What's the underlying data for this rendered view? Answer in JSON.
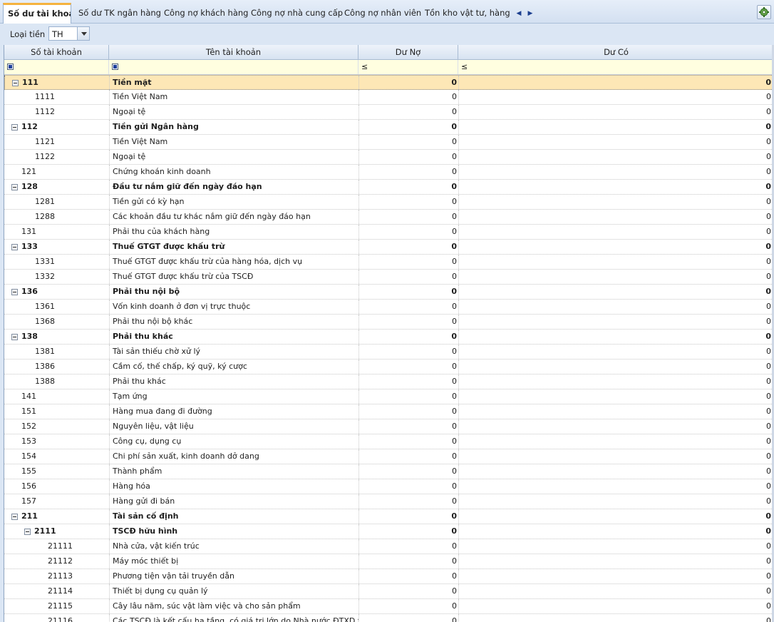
{
  "tabs": [
    {
      "label": "Số dư tài khoản",
      "active": true
    },
    {
      "label": "Số dư TK ngân hàng"
    },
    {
      "label": "Công nợ khách hàng"
    },
    {
      "label": "Công nợ nhà cung cấp"
    },
    {
      "label": "Công nợ nhân viên"
    },
    {
      "label": "Tồn kho vật tư, hàng hóa"
    }
  ],
  "toolbar": {
    "currency_label": "Loại tiền",
    "currency_value": "TH"
  },
  "columns": {
    "account_no": "Số tài khoản",
    "account_name": "Tên tài khoản",
    "debit": "Dư Nợ",
    "credit": "Dư Có"
  },
  "filter": {
    "debit_op": "≤",
    "credit_op": "≤"
  },
  "rows": [
    {
      "code": "111",
      "name": "Tiền mặt",
      "debit": "0",
      "credit": "0",
      "level": 0,
      "group": true
    },
    {
      "code": "1111",
      "name": "Tiền Việt Nam",
      "debit": "0",
      "credit": "0",
      "level": 1
    },
    {
      "code": "1112",
      "name": "Ngoại tệ",
      "debit": "0",
      "credit": "0",
      "level": 1
    },
    {
      "code": "112",
      "name": "Tiền gửi Ngân hàng",
      "debit": "0",
      "credit": "0",
      "level": 0,
      "group": true
    },
    {
      "code": "1121",
      "name": "Tiền Việt Nam",
      "debit": "0",
      "credit": "0",
      "level": 1
    },
    {
      "code": "1122",
      "name": "Ngoại tệ",
      "debit": "0",
      "credit": "0",
      "level": 1
    },
    {
      "code": "121",
      "name": "Chứng khoán kinh doanh",
      "debit": "0",
      "credit": "0",
      "level": 0
    },
    {
      "code": "128",
      "name": "Đầu tư nắm giữ đến ngày đáo hạn",
      "debit": "0",
      "credit": "0",
      "level": 0,
      "group": true
    },
    {
      "code": "1281",
      "name": "Tiền gửi có kỳ hạn",
      "debit": "0",
      "credit": "0",
      "level": 1
    },
    {
      "code": "1288",
      "name": "Các khoản đầu tư khác nắm giữ đến ngày đáo hạn",
      "debit": "0",
      "credit": "0",
      "level": 1
    },
    {
      "code": "131",
      "name": "Phải thu của khách hàng",
      "debit": "0",
      "credit": "0",
      "level": 0
    },
    {
      "code": "133",
      "name": "Thuế GTGT được khấu trừ",
      "debit": "0",
      "credit": "0",
      "level": 0,
      "group": true
    },
    {
      "code": "1331",
      "name": "Thuế GTGT được khấu trừ của hàng hóa, dịch vụ",
      "debit": "0",
      "credit": "0",
      "level": 1
    },
    {
      "code": "1332",
      "name": "Thuế GTGT được khấu trừ của TSCĐ",
      "debit": "0",
      "credit": "0",
      "level": 1
    },
    {
      "code": "136",
      "name": "Phải thu nội bộ",
      "debit": "0",
      "credit": "0",
      "level": 0,
      "group": true
    },
    {
      "code": "1361",
      "name": "Vốn kinh doanh ở đơn vị trực thuộc",
      "debit": "0",
      "credit": "0",
      "level": 1
    },
    {
      "code": "1368",
      "name": "Phải thu nội bộ khác",
      "debit": "0",
      "credit": "0",
      "level": 1
    },
    {
      "code": "138",
      "name": "Phải thu khác",
      "debit": "0",
      "credit": "0",
      "level": 0,
      "group": true
    },
    {
      "code": "1381",
      "name": "Tài sản thiếu chờ xử lý",
      "debit": "0",
      "credit": "0",
      "level": 1
    },
    {
      "code": "1386",
      "name": "Cầm cố, thế chấp, ký quỹ, ký cược",
      "debit": "0",
      "credit": "0",
      "level": 1
    },
    {
      "code": "1388",
      "name": "Phải thu khác",
      "debit": "0",
      "credit": "0",
      "level": 1
    },
    {
      "code": "141",
      "name": "Tạm ứng",
      "debit": "0",
      "credit": "0",
      "level": 0
    },
    {
      "code": "151",
      "name": "Hàng mua đang đi đường",
      "debit": "0",
      "credit": "0",
      "level": 0
    },
    {
      "code": "152",
      "name": "Nguyên liệu, vật liệu",
      "debit": "0",
      "credit": "0",
      "level": 0
    },
    {
      "code": "153",
      "name": "Công cụ, dụng cụ",
      "debit": "0",
      "credit": "0",
      "level": 0
    },
    {
      "code": "154",
      "name": "Chi phí sản xuất, kinh doanh dở dang",
      "debit": "0",
      "credit": "0",
      "level": 0
    },
    {
      "code": "155",
      "name": "Thành phẩm",
      "debit": "0",
      "credit": "0",
      "level": 0
    },
    {
      "code": "156",
      "name": "Hàng hóa",
      "debit": "0",
      "credit": "0",
      "level": 0
    },
    {
      "code": "157",
      "name": "Hàng gửi đi bán",
      "debit": "0",
      "credit": "0",
      "level": 0
    },
    {
      "code": "211",
      "name": "Tài sản cố định",
      "debit": "0",
      "credit": "0",
      "level": 0,
      "group": true
    },
    {
      "code": "2111",
      "name": "TSCĐ hữu hình",
      "debit": "0",
      "credit": "0",
      "level": 1,
      "group": true
    },
    {
      "code": "21111",
      "name": "Nhà cửa, vật kiến trúc",
      "debit": "0",
      "credit": "0",
      "level": 2
    },
    {
      "code": "21112",
      "name": "Máy móc thiết bị",
      "debit": "0",
      "credit": "0",
      "level": 2
    },
    {
      "code": "21113",
      "name": "Phương tiện vận tải truyền dẫn",
      "debit": "0",
      "credit": "0",
      "level": 2
    },
    {
      "code": "21114",
      "name": "Thiết bị dụng cụ quản lý",
      "debit": "0",
      "credit": "0",
      "level": 2
    },
    {
      "code": "21115",
      "name": "Cây lâu năm, súc vật làm việc và cho sản phẩm",
      "debit": "0",
      "credit": "0",
      "level": 2
    },
    {
      "code": "21116",
      "name": "Các TSCĐ là kết cấu hạ tầng, có giá trị lớn do Nhà nước ĐTXD từ",
      "debit": "0",
      "credit": "0",
      "level": 2
    }
  ]
}
